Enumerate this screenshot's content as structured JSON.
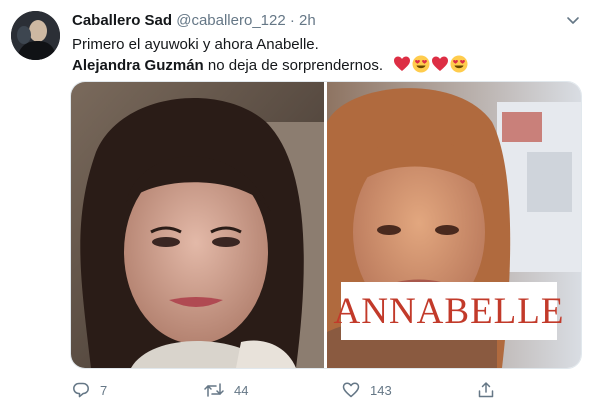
{
  "tweet": {
    "display_name": "Caballero Sad",
    "handle": "@caballero_122",
    "separator": "·",
    "time": "2h",
    "line1": "Primero el ayuwoki y ahora Anabelle.",
    "line2_bold": "Alejandra Guzmán",
    "line2_rest": " no deja de sorprendernos.",
    "emojis": [
      "red-heart-icon",
      "heart-eyes-face-icon",
      "red-heart-icon",
      "heart-eyes-face-icon"
    ],
    "media_caption": "ANNABELLE"
  },
  "actions": {
    "reply_count": "7",
    "retweet_count": "44",
    "like_count": "143"
  },
  "colors": {
    "text_primary": "#14171a",
    "text_secondary": "#657786",
    "caption_red": "#c23a2a",
    "heart_red": "#dd2e44"
  }
}
